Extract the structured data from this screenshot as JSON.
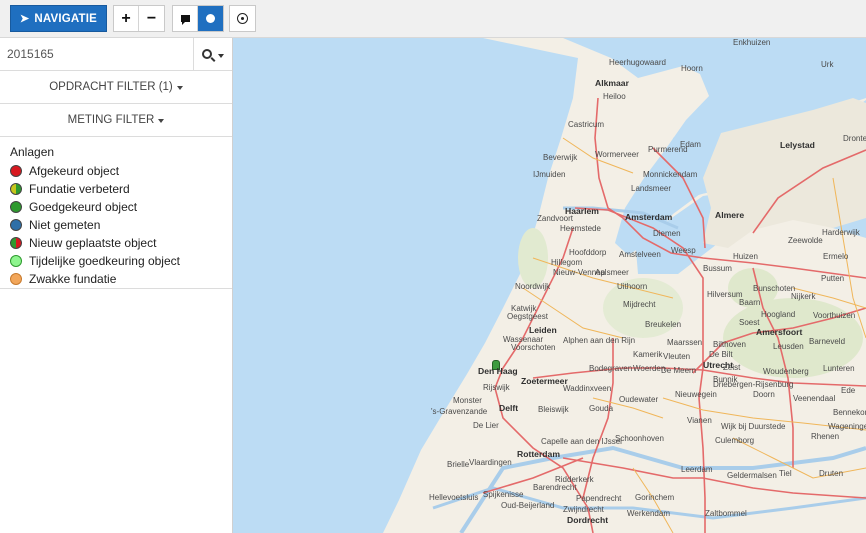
{
  "toolbar": {
    "nav_label": "NAVIGATIE",
    "zoom_in": "+",
    "zoom_out": "−"
  },
  "search": {
    "value": "2015165"
  },
  "filters": {
    "opdracht": "OPDRACHT FILTER (1)",
    "meting": "METING FILTER"
  },
  "legend": {
    "title": "Anlagen",
    "items": [
      {
        "label": "Afgekeurd object",
        "color": "#d71920"
      },
      {
        "label": "Fundatie verbeterd",
        "color": "#c6c61d"
      },
      {
        "label": "Goedgekeurd object",
        "color": "#2e9a2e"
      },
      {
        "label": "Niet gemeten",
        "color": "#2f6fa7"
      },
      {
        "label": "Nieuw geplaatste object",
        "color": "#d71920"
      },
      {
        "label": "Tijdelijke goedkeuring object",
        "color": "#8ef58e"
      },
      {
        "label": "Zwakke fundatie",
        "color": "#f2a65a"
      }
    ]
  },
  "map": {
    "places": [
      "Enkhuizen",
      "Heerhugowaard",
      "Hoorn",
      "Alkmaar",
      "Heiloo",
      "Castricum",
      "Purmerend",
      "Edam",
      "Beverwijk",
      "Wormerveer",
      "IJmuiden",
      "Monnickendam",
      "Landsmeer",
      "Haarlem",
      "Amsterdam",
      "Almere",
      "Lelystad",
      "Zandvoort",
      "Heemstede",
      "Diemen",
      "Harderwijk",
      "Hillegom",
      "Hoofddorp",
      "Weesp",
      "Huizen",
      "Ermelo",
      "Amstelveen",
      "Zeewolde",
      "Nieuw-Vennep",
      "Aalsmeer",
      "Bussum",
      "Noordwijk",
      "Uithoorn",
      "Hilversum",
      "Baarn",
      "Nijkerk",
      "Katwijk",
      "Oegstgeest",
      "Mijdrecht",
      "Soest",
      "Hoogland",
      "Leiden",
      "Breukelen",
      "Amersfoort",
      "Wassenaar",
      "Voorschoten",
      "Alphen aan den Rijn",
      "Maarssen",
      "Bilthoven",
      "De Bilt",
      "Den Haag",
      "Vleuten",
      "Utrecht",
      "Zeist",
      "Woudenberg",
      "Bodegraven",
      "Woerden",
      "De Meern",
      "Zoetermeer",
      "Rijswijk",
      "Waddinxveen",
      "Nieuwegein",
      "Driebergen-Rijsenburg",
      "Doorn",
      "Monster",
      "Delft",
      "Bleiswijk",
      "Gouda",
      "Oudewater",
      "Vianen",
      "Wijk bij Duurstede",
      "Wageningen",
      "Rhenen",
      "Veenendaal",
      "Bennekom",
      "Culemborg",
      "Schoonhoven",
      "'s-Gravenzande",
      "De Lier",
      "Capelle aan den IJssel",
      "Rotterdam",
      "Vlaardingen",
      "Brielle",
      "Barendrecht",
      "Ridderkerk",
      "Hellevoetsluis",
      "Spijkenisse",
      "Oud-Beijerland",
      "Zwijndrecht",
      "Papendrecht",
      "Gorinchem",
      "Dordrecht",
      "Leerdam",
      "Geldermalsen",
      "Tiel",
      "Druten",
      "Werkendam",
      "Zaltbommel",
      "Urk",
      "Dronten",
      "Lunteren",
      "Ede",
      "Putten",
      "Voorthuizen",
      "Barneveld",
      "Bunschoten",
      "Leusden",
      "Bunnik",
      "Kamerik"
    ]
  }
}
